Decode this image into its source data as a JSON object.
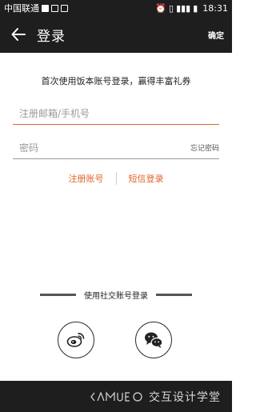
{
  "status_bar": {
    "carrier": "中国联通",
    "time": "18:31"
  },
  "app_bar": {
    "title": "登录",
    "confirm_label": "确定"
  },
  "form": {
    "promo_text": "首次使用饭本账号登录，赢得丰富礼券",
    "account_placeholder": "注册邮箱/手机号",
    "password_placeholder": "密码",
    "forgot_label": "忘记密码"
  },
  "links": {
    "register_label": "注册账号",
    "sms_login_label": "短信登录"
  },
  "social": {
    "heading": "使用社交账号登录",
    "buttons": [
      {
        "icon": "weibo-icon"
      },
      {
        "icon": "wechat-icon"
      }
    ]
  },
  "watermark": {
    "text": "交互设计学堂"
  },
  "colors": {
    "accent": "#e0652a",
    "bar_bg": "#1e1e1e"
  }
}
